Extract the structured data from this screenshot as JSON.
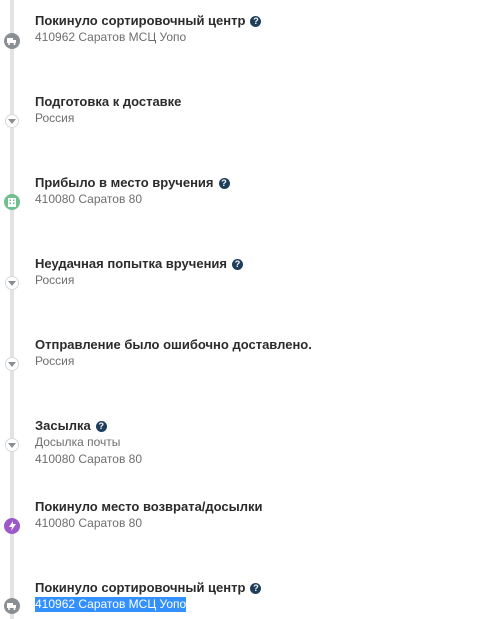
{
  "events": [
    {
      "title": "Покинуло сортировочный центр",
      "help": "?",
      "lines": [
        "410962 Саратов МСЦ Уопо"
      ],
      "icon": "truck-icon",
      "icon_color": "#8a8f94"
    },
    {
      "title": "Подготовка к доставке",
      "lines": [
        "Россия"
      ],
      "icon": "chevron-down-icon"
    },
    {
      "title": "Прибыло в место вручения",
      "help": "?",
      "lines": [
        "410080 Саратов 80"
      ],
      "icon": "building-icon",
      "icon_color": "#6fbf8f"
    },
    {
      "title": "Неудачная попытка вручения",
      "help": "?",
      "lines": [
        "Россия"
      ],
      "icon": "chevron-down-icon"
    },
    {
      "title": "Отправление было ошибочно доставлено.",
      "lines": [
        "Россия"
      ],
      "icon": "chevron-down-icon"
    },
    {
      "title": "Засылка",
      "help": "?",
      "lines": [
        "Досылка почты",
        "410080 Саратов 80"
      ],
      "icon": "chevron-down-icon"
    },
    {
      "title": "Покинуло место возврата/досылки",
      "lines": [
        "410080 Саратов 80"
      ],
      "icon": "lightning-icon",
      "icon_color": "#9b59c9"
    },
    {
      "title": "Покинуло сортировочный центр",
      "help": "?",
      "lines": [
        "410962 Саратов МСЦ Уопо"
      ],
      "icon": "truck-icon",
      "icon_color": "#8a8f94",
      "selected_line": true
    }
  ]
}
